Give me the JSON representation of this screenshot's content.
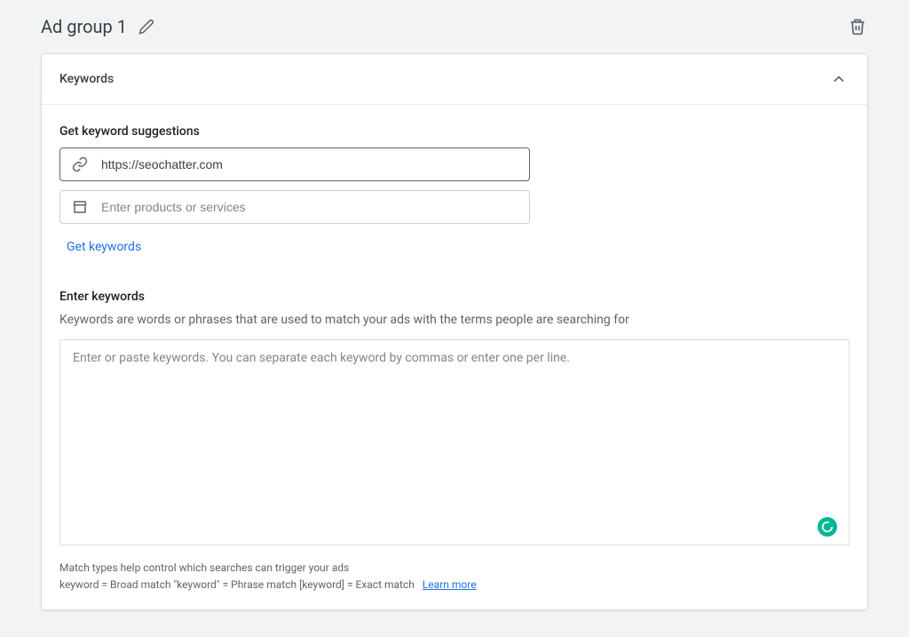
{
  "header": {
    "title": "Ad group 1"
  },
  "section": {
    "title": "Keywords"
  },
  "suggestions": {
    "heading": "Get keyword suggestions",
    "url_input_value": "https://seochatter.com",
    "products_placeholder": "Enter products or services",
    "get_keywords_label": "Get keywords"
  },
  "enter_keywords": {
    "heading": "Enter keywords",
    "helper": "Keywords are words or phrases that are used to match your ads with the terms people are searching for",
    "textarea_placeholder": "Enter or paste keywords. You can separate each keyword by commas or enter one per line."
  },
  "footer": {
    "line1": "Match types help control which searches can trigger your ads",
    "line2": "keyword = Broad match   \"keyword\" = Phrase match   [keyword] = Exact match",
    "learn_more": "Learn more"
  }
}
